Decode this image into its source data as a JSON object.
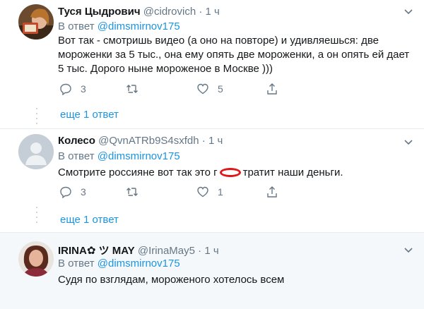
{
  "tweets": [
    {
      "name": "Туся Цыдрович",
      "handle": "@cidrovich",
      "dot": "·",
      "time": "1 ч",
      "reply_prefix": "В ответ",
      "reply_to": "@dimsmirnov175",
      "text": "Вот так - смотришь видео (а оно на повторе) и удивляешься: две мороженки за 5 тыс., она ему опять две мороженки, а он опять ей дает 5 тыс. Дорого ныне мороженое в Москве )))",
      "replies": "3",
      "retweets": "",
      "likes": "5",
      "more_replies": "еще 1 ответ"
    },
    {
      "name": "Колесо",
      "handle": "@QvnATRb9S4sxfdh",
      "dot": "·",
      "time": "1 ч",
      "reply_prefix": "В ответ",
      "reply_to": "@dimsmirnov175",
      "text_before": "Смотрите россияне вот так это г",
      "text_after": "тратит наши деньги.",
      "replies": "3",
      "retweets": "",
      "likes": "1",
      "more_replies": "еще 1 ответ"
    },
    {
      "name": "IRINA✿ ツ MAY",
      "handle": "@IrinaMay5",
      "dot": "·",
      "time": "1 ч",
      "reply_prefix": "В ответ",
      "reply_to": "@dimsmirnov175",
      "text": "Судя по взглядам, мороженого хотелось всем"
    }
  ],
  "icons": {
    "reply": "reply-icon",
    "retweet": "retweet-icon",
    "like": "heart-icon",
    "share": "share-icon",
    "menu": "chevron-down-icon"
  },
  "colors": {
    "link": "#1b95e0",
    "muted": "#657786",
    "text": "#14171a",
    "highlight_bg": "#f5f8fa",
    "annotation": "#e0161b"
  }
}
